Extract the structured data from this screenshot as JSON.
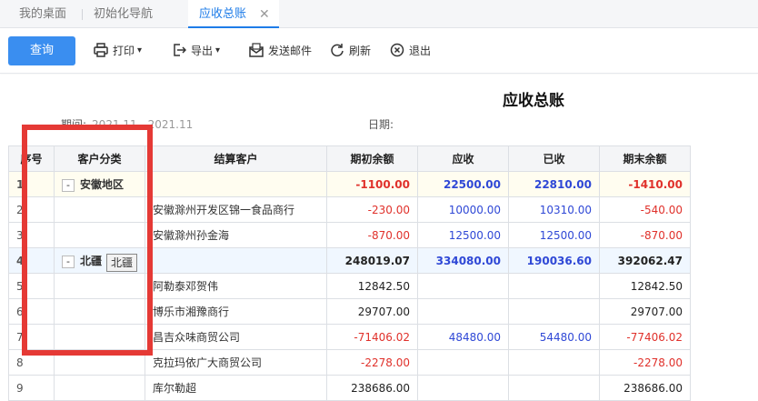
{
  "tabs": [
    {
      "label": "我的桌面"
    },
    {
      "label": "初始化导航"
    },
    {
      "label": "应收总账",
      "close": "✕"
    }
  ],
  "toolbar": {
    "query": "查询",
    "print": "打印",
    "export": "导出",
    "email": "发送邮件",
    "refresh": "刷新",
    "exit": "退出"
  },
  "report": {
    "title": "应收总账",
    "period_label": "期间:",
    "period_value": "2021.11 - 2021.11",
    "date_label": "日期:",
    "tooltip": "北疆",
    "columns": [
      "序号",
      "客户分类",
      "结算客户",
      "期初余额",
      "应收",
      "已收",
      "期末余额"
    ],
    "rows": [
      {
        "seq": "1",
        "category": "安徽地区",
        "customer": "",
        "opening": "-1100.00",
        "receivable": "22500.00",
        "received": "22810.00",
        "closing": "-1410.00"
      },
      {
        "seq": "2",
        "category": "",
        "customer": "安徽滁州开发区锦一食品商行",
        "opening": "-230.00",
        "receivable": "10000.00",
        "received": "10310.00",
        "closing": "-540.00"
      },
      {
        "seq": "3",
        "category": "",
        "customer": "安徽滁州孙金海",
        "opening": "-870.00",
        "receivable": "12500.00",
        "received": "12500.00",
        "closing": "-870.00"
      },
      {
        "seq": "4",
        "category": "北疆",
        "customer": "",
        "opening": "248019.07",
        "receivable": "334080.00",
        "received": "190036.60",
        "closing": "392062.47"
      },
      {
        "seq": "5",
        "category": "",
        "customer": "阿勒泰邓贺伟",
        "opening": "12842.50",
        "receivable": "",
        "received": "",
        "closing": "12842.50"
      },
      {
        "seq": "6",
        "category": "",
        "customer": "博乐市湘豫商行",
        "opening": "29707.00",
        "receivable": "",
        "received": "",
        "closing": "29707.00"
      },
      {
        "seq": "7",
        "category": "",
        "customer": "昌吉众味商贸公司",
        "opening": "-71406.02",
        "receivable": "48480.00",
        "received": "54480.00",
        "closing": "-77406.02"
      },
      {
        "seq": "8",
        "category": "",
        "customer": "克拉玛依广大商贸公司",
        "opening": "-2278.00",
        "receivable": "",
        "received": "",
        "closing": "-2278.00"
      },
      {
        "seq": "9",
        "category": "",
        "customer": "库尔勒超",
        "opening": "238686.00",
        "receivable": "",
        "received": "",
        "closing": "238686.00"
      }
    ]
  },
  "colors": {
    "accent": "#1e7ce8",
    "primary_button": "#3a8ef0",
    "negative": "#e0312b",
    "positive": "#2f48d6",
    "highlight_box": "#e53935"
  }
}
